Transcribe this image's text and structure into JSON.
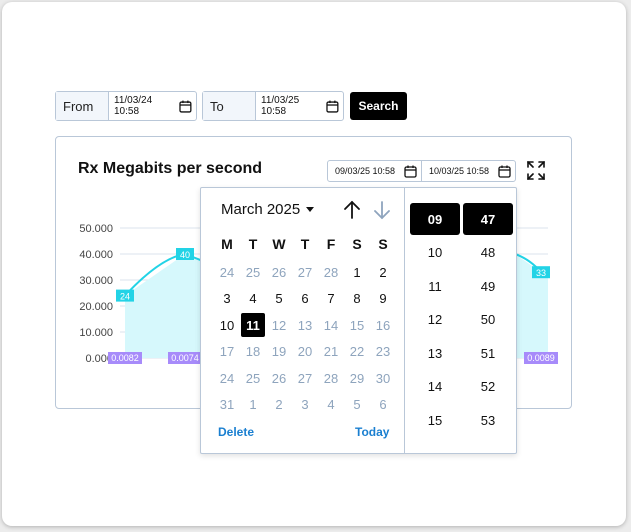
{
  "filters": {
    "from_label": "From",
    "from_value": "11/03/24 10:58",
    "to_label": "To",
    "to_value": "11/03/25 10:58",
    "search_label": "Search"
  },
  "card": {
    "title": "Rx Megabits per second",
    "range_start": "09/03/25 10:58",
    "range_end": "10/03/25 10:58"
  },
  "chart_data": {
    "type": "area",
    "title": "Rx Megabits per second",
    "y_ticks": [
      "50.000",
      "40.000",
      "30.000",
      "20.000",
      "10.000",
      "0.000"
    ],
    "ylim": [
      0,
      50
    ],
    "visible_points": [
      {
        "value": 24,
        "label": "24"
      },
      {
        "value": 40,
        "label": "40"
      },
      {
        "value": 33,
        "label": "33"
      }
    ],
    "bottom_labels": [
      "0.0082",
      "0.0074",
      "0.0089"
    ],
    "colors": {
      "line": "#22d3e6",
      "fill": "#d6f8fc",
      "bottom_label_bg": "#a78bfa"
    },
    "grid": true
  },
  "picker": {
    "month_label": "March 2025",
    "weekdays": [
      "M",
      "T",
      "W",
      "T",
      "F",
      "S",
      "S"
    ],
    "weeks": [
      [
        {
          "d": "24",
          "m": true
        },
        {
          "d": "25",
          "m": true
        },
        {
          "d": "26",
          "m": true
        },
        {
          "d": "27",
          "m": true
        },
        {
          "d": "28",
          "m": true
        },
        {
          "d": "1",
          "m": false
        },
        {
          "d": "2",
          "m": false
        }
      ],
      [
        {
          "d": "3",
          "m": false
        },
        {
          "d": "4",
          "m": false
        },
        {
          "d": "5",
          "m": false
        },
        {
          "d": "6",
          "m": false
        },
        {
          "d": "7",
          "m": false
        },
        {
          "d": "8",
          "m": false
        },
        {
          "d": "9",
          "m": false
        }
      ],
      [
        {
          "d": "10",
          "m": false
        },
        {
          "d": "11",
          "m": false,
          "sel": true
        },
        {
          "d": "12",
          "m": true
        },
        {
          "d": "13",
          "m": true
        },
        {
          "d": "14",
          "m": true
        },
        {
          "d": "15",
          "m": true
        },
        {
          "d": "16",
          "m": true
        }
      ],
      [
        {
          "d": "17",
          "m": true
        },
        {
          "d": "18",
          "m": true
        },
        {
          "d": "19",
          "m": true
        },
        {
          "d": "20",
          "m": true
        },
        {
          "d": "21",
          "m": true
        },
        {
          "d": "22",
          "m": true
        },
        {
          "d": "23",
          "m": true
        }
      ],
      [
        {
          "d": "24",
          "m": true
        },
        {
          "d": "25",
          "m": true
        },
        {
          "d": "26",
          "m": true
        },
        {
          "d": "27",
          "m": true
        },
        {
          "d": "28",
          "m": true
        },
        {
          "d": "29",
          "m": true
        },
        {
          "d": "30",
          "m": true
        }
      ],
      [
        {
          "d": "31",
          "m": true
        },
        {
          "d": "1",
          "m": true
        },
        {
          "d": "2",
          "m": true
        },
        {
          "d": "3",
          "m": true
        },
        {
          "d": "4",
          "m": true
        },
        {
          "d": "5",
          "m": true
        },
        {
          "d": "6",
          "m": true
        }
      ]
    ],
    "delete_label": "Delete",
    "today_label": "Today",
    "hours": [
      "09",
      "10",
      "11",
      "12",
      "13",
      "14",
      "15"
    ],
    "minutes": [
      "47",
      "48",
      "49",
      "50",
      "51",
      "52",
      "53"
    ],
    "selected_hour": "09",
    "selected_minute": "47"
  }
}
